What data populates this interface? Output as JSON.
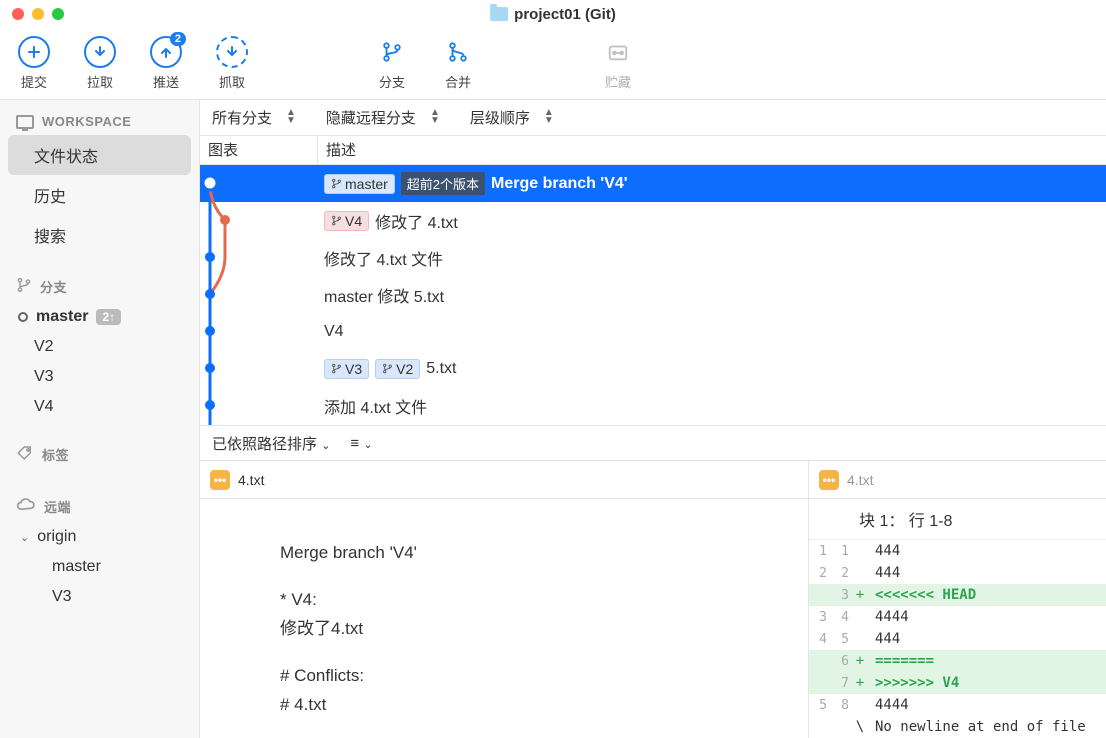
{
  "title": "project01 (Git)",
  "toolbar": {
    "commit": "提交",
    "pull": "拉取",
    "push": "推送",
    "push_badge": "2",
    "fetch": "抓取",
    "branch": "分支",
    "merge": "合并",
    "stash": "贮藏"
  },
  "sidebar": {
    "workspace_label": "WORKSPACE",
    "file_status": "文件状态",
    "history": "历史",
    "search": "搜索",
    "branches_label": "分支",
    "branches": [
      {
        "name": "master",
        "current": true,
        "badge": "2↑"
      },
      {
        "name": "V2",
        "current": false
      },
      {
        "name": "V3",
        "current": false
      },
      {
        "name": "V4",
        "current": false
      }
    ],
    "tags_label": "标签",
    "remotes_label": "远端",
    "origin_label": "origin",
    "origin_branches": [
      "master",
      "V3"
    ]
  },
  "filterbar": {
    "all_branches": "所有分支",
    "hide_remote": "隐藏远程分支",
    "tier_order": "层级顺序"
  },
  "columns": {
    "graph": "图表",
    "desc": "描述"
  },
  "commits": [
    {
      "tags": [
        {
          "kind": "branch",
          "text": "master"
        }
      ],
      "ahead": "超前2个版本",
      "desc": "Merge branch 'V4'",
      "selected": true
    },
    {
      "tags": [
        {
          "kind": "pink",
          "text": "V4"
        }
      ],
      "desc": "修改了 4.txt"
    },
    {
      "tags": [],
      "desc": "修改了 4.txt 文件"
    },
    {
      "tags": [],
      "desc": "master 修改 5.txt"
    },
    {
      "tags": [],
      "desc": "V4"
    },
    {
      "tags": [
        {
          "kind": "branch",
          "text": "V3"
        },
        {
          "kind": "branch",
          "text": "V2"
        }
      ],
      "desc": "5.txt"
    },
    {
      "tags": [],
      "desc": "添加 4.txt 文件"
    }
  ],
  "sortbar": {
    "label": "已依照路径排序"
  },
  "file_tab": {
    "name": "4.txt"
  },
  "commit_msg": {
    "l1": "Merge branch 'V4'",
    "l2": "* V4:",
    "l3": "修改了4.txt",
    "l4": "# Conflicts:",
    "l5": "#\t4.txt"
  },
  "right_file": "4.txt",
  "hunk_header": "块 1： 行 1-8",
  "diff": [
    {
      "ol": "1",
      "nl": "1",
      "s": "",
      "t": "444",
      "cls": "ctx"
    },
    {
      "ol": "2",
      "nl": "2",
      "s": "",
      "t": "444",
      "cls": "ctx"
    },
    {
      "ol": "",
      "nl": "3",
      "s": "+",
      "t": "<<<<<<< HEAD",
      "cls": "add",
      "green": true
    },
    {
      "ol": "3",
      "nl": "4",
      "s": "",
      "t": "4444",
      "cls": "ctx"
    },
    {
      "ol": "4",
      "nl": "5",
      "s": "",
      "t": "444",
      "cls": "ctx"
    },
    {
      "ol": "",
      "nl": "6",
      "s": "+",
      "t": "=======",
      "cls": "add",
      "green": true
    },
    {
      "ol": "",
      "nl": "7",
      "s": "+",
      "t": ">>>>>>> V4",
      "cls": "add",
      "green": true
    },
    {
      "ol": "5",
      "nl": "8",
      "s": "",
      "t": "4444",
      "cls": "ctx"
    },
    {
      "ol": "",
      "nl": "",
      "s": "\\",
      "t": "No newline at end of file",
      "cls": "ctx"
    }
  ]
}
